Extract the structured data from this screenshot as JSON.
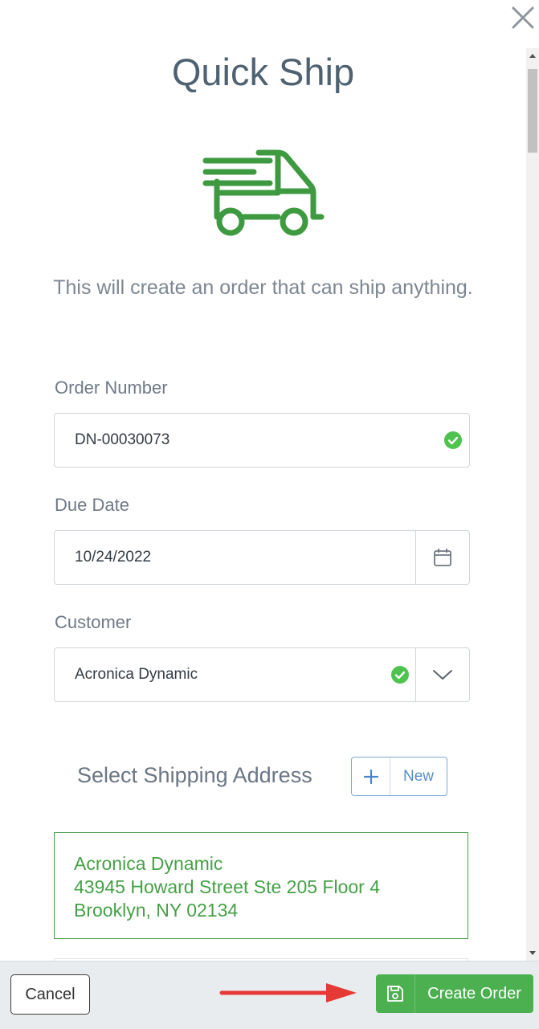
{
  "dialog": {
    "title": "Quick Ship",
    "subtitle": "This will create an order that can ship anything.",
    "icon": "delivery-truck-icon",
    "accent_color": "#4caf50"
  },
  "form": {
    "order_number": {
      "label": "Order Number",
      "value": "DN-00030073",
      "valid": true
    },
    "due_date": {
      "label": "Due Date",
      "value": "10/24/2022"
    },
    "customer": {
      "label": "Customer",
      "value": "Acronica Dynamic",
      "valid": true
    }
  },
  "shipping": {
    "section_title": "Select Shipping Address",
    "new_button_label": "New",
    "addresses": [
      {
        "name": "Acronica Dynamic",
        "street": "43945 Howard Street Ste 205 Floor 4",
        "city_state_zip": "Brooklyn, NY 02134",
        "selected": true
      }
    ]
  },
  "footer": {
    "cancel_label": "Cancel",
    "create_label": "Create Order"
  }
}
